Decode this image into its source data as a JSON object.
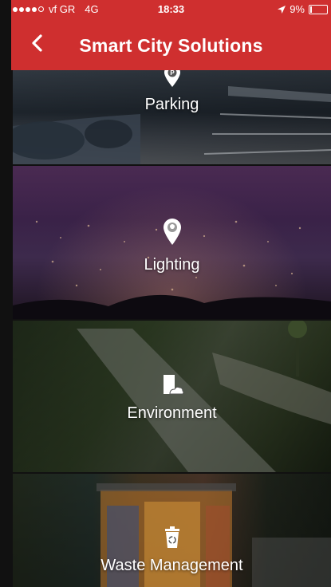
{
  "status_bar": {
    "carrier": "vf GR",
    "network": "4G",
    "time": "18:33",
    "battery_percent": "9%",
    "signal_dots_filled": 4,
    "signal_dots_total": 5
  },
  "header": {
    "title": "Smart City Solutions",
    "back_icon": "chevron-left-icon",
    "background_color": "#cf2f2f"
  },
  "tiles": [
    {
      "label": "Parking",
      "icon": "parking-pin-icon"
    },
    {
      "label": "Lighting",
      "icon": "light-bulb-pin-icon"
    },
    {
      "label": "Environment",
      "icon": "environment-icon"
    },
    {
      "label": "Waste Management",
      "icon": "recycle-bin-icon"
    }
  ]
}
